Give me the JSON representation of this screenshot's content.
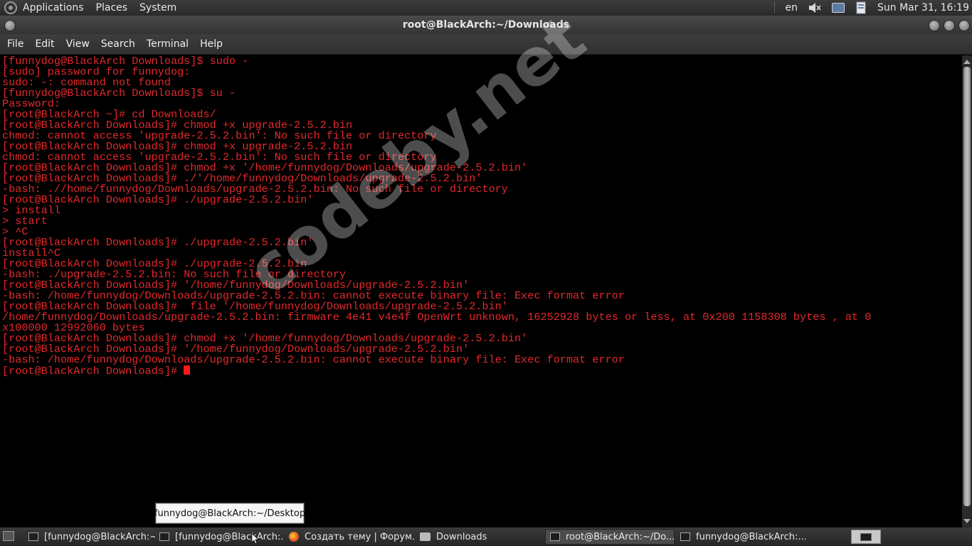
{
  "top_panel": {
    "menus": [
      "Applications",
      "Places",
      "System"
    ],
    "keyboard_layout": "en",
    "clock": "Sun Mar 31, 16:19"
  },
  "window": {
    "title": "root@BlackArch:~/Downloads"
  },
  "menubar": {
    "items": [
      "File",
      "Edit",
      "View",
      "Search",
      "Terminal",
      "Help"
    ]
  },
  "terminal": {
    "lines": [
      "[funnydog@BlackArch Downloads]$ sudo -",
      "[sudo] password for funnydog:",
      "sudo: -: command not found",
      "[funnydog@BlackArch Downloads]$ su -",
      "Password:",
      "[root@BlackArch ~]# cd Downloads/",
      "[root@BlackArch Downloads]# chmod +x upgrade-2.5.2.bin",
      "chmod: cannot access 'upgrade-2.5.2.bin': No such file or directory",
      "[root@BlackArch Downloads]# chmod +x upgrade-2.5.2.bin",
      "chmod: cannot access 'upgrade-2.5.2.bin': No such file or directory",
      "[root@BlackArch Downloads]# chmod +x '/home/funnydog/Downloads/upgrade-2.5.2.bin'",
      "[root@BlackArch Downloads]# ./'/home/funnydog/Downloads/upgrade-2.5.2.bin'",
      "-bash: .//home/funnydog/Downloads/upgrade-2.5.2.bin: No such file or directory",
      "[root@BlackArch Downloads]# ./upgrade-2.5.2.bin'",
      "> install",
      "> start",
      "> ^C",
      "[root@BlackArch Downloads]# ./upgrade-2.5.2.bin'",
      "install^C",
      "[root@BlackArch Downloads]# ./upgrade-2.5.2.bin",
      "-bash: ./upgrade-2.5.2.bin: No such file or directory",
      "[root@BlackArch Downloads]# '/home/funnydog/Downloads/upgrade-2.5.2.bin'",
      "-bash: /home/funnydog/Downloads/upgrade-2.5.2.bin: cannot execute binary file: Exec format error",
      "[root@BlackArch Downloads]#  file '/home/funnydog/Downloads/upgrade-2.5.2.bin'",
      "/home/funnydog/Downloads/upgrade-2.5.2.bin: firmware 4e41 v4e4f OpenWrt unknown, 16252928 bytes or less, at 0x200 1158308 bytes , at 0",
      "x100000 12992060 bytes",
      "[root@BlackArch Downloads]# chmod +x '/home/funnydog/Downloads/upgrade-2.5.2.bin'",
      "[root@BlackArch Downloads]# '/home/funnydog/Downloads/upgrade-2.5.2.bin'",
      "-bash: /home/funnydog/Downloads/upgrade-2.5.2.bin: cannot execute binary file: Exec format error"
    ],
    "prompt": "[root@BlackArch Downloads]# "
  },
  "watermark": "codeby.net",
  "tooltip": "funnydog@BlackArch:~/Desktop",
  "taskbar": {
    "items": [
      "[funnydog@BlackArch:~]",
      "[funnydog@BlackArch:...",
      "Создать тему | Форум...",
      "Downloads",
      "root@BlackArch:~/Do...",
      "funnydog@BlackArch:..."
    ]
  }
}
